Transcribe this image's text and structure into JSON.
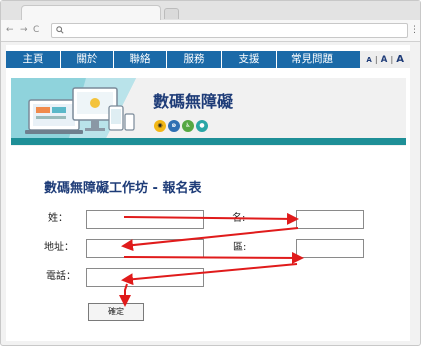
{
  "browser": {
    "back_glyph": "←",
    "forward_glyph": "→",
    "reload_glyph": "C",
    "address_icon": "search-icon",
    "address_value": "",
    "menu_glyph": "⋮"
  },
  "nav": {
    "items": [
      "主頁",
      "關於",
      "聯絡",
      "服務",
      "支援",
      "常見問題"
    ],
    "font_size_controls": [
      "A",
      "A",
      "A"
    ]
  },
  "banner": {
    "title": "數碼無障礙",
    "icons": [
      "eye-icon",
      "hearing-icon",
      "wheelchair-icon",
      "brain-icon"
    ]
  },
  "form": {
    "title": "數碼無障礙工作坊 - 報名表",
    "surname_label": "姓：",
    "given_name_label": "名:",
    "address_label": "地址：",
    "district_label": "區:",
    "phone_label": "電話：",
    "surname_value": "",
    "given_name_value": "",
    "address_value": "",
    "district_value": "",
    "phone_value": "",
    "confirm_label": "確定"
  },
  "colors": {
    "nav_bg": "#1b6aa8",
    "title": "#1e3c78",
    "stripe": "#1e8f97",
    "arrow": "#e01b1b"
  }
}
